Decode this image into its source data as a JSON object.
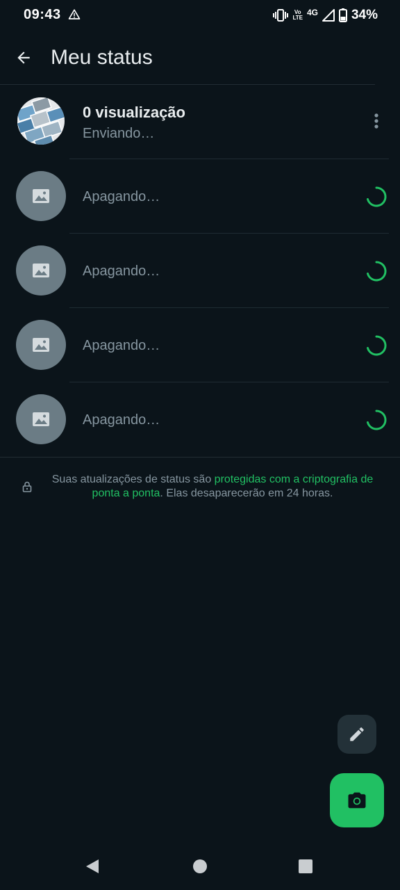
{
  "status_bar": {
    "time": "09:43",
    "warning_icon": "warning-triangle-icon",
    "vibrate_icon": "vibrate-icon",
    "volte_top": "Vo",
    "volte_bottom": "LTE",
    "network": "4G",
    "signal_icon": "signal-icon",
    "battery_icon": "battery-icon",
    "battery_percent": "34%"
  },
  "app_bar": {
    "back_icon": "arrow-back-icon",
    "title": "Meu status"
  },
  "my_status": {
    "views": "0 visualização",
    "state": "Enviando…",
    "more_icon": "more-vert-icon"
  },
  "deleting_items": [
    {
      "label": "Apagando…",
      "icon": "image-placeholder-icon"
    },
    {
      "label": "Apagando…",
      "icon": "image-placeholder-icon"
    },
    {
      "label": "Apagando…",
      "icon": "image-placeholder-icon"
    },
    {
      "label": "Apagando…",
      "icon": "image-placeholder-icon"
    }
  ],
  "encryption_note": {
    "prefix": "Suas atualizações de status são ",
    "link": "protegidas com a criptografia de ponta a ponta",
    "suffix": ". Elas desaparecerão em 24 horas."
  },
  "fabs": {
    "pencil_icon": "pencil-icon",
    "camera_icon": "camera-icon"
  },
  "colors": {
    "background": "#0b141a",
    "accent": "#21c063",
    "secondary_text": "#8696a0",
    "primary_text": "#e9edef"
  }
}
